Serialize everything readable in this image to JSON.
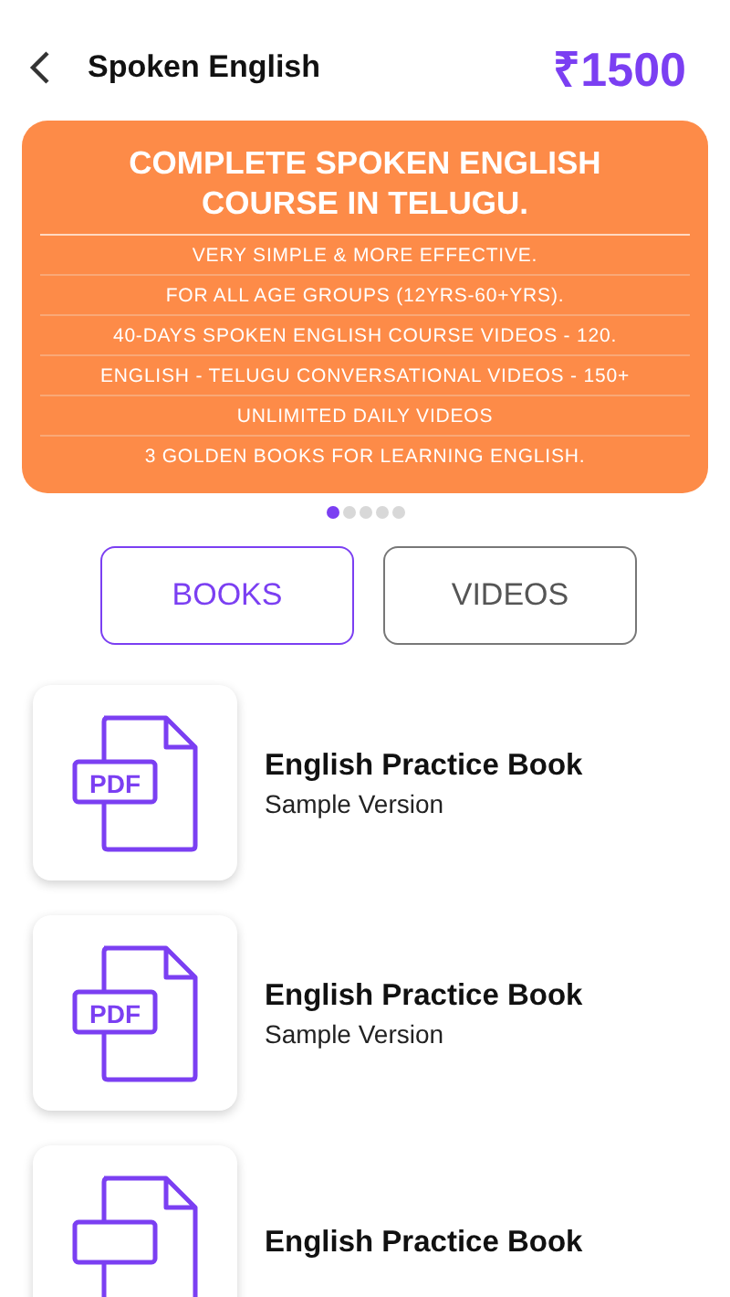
{
  "header": {
    "title": "Spoken English",
    "price": "₹1500"
  },
  "banner": {
    "heading": "COMPLETE SPOKEN ENGLISH COURSE IN TELUGU.",
    "points": [
      "VERY SIMPLE & MORE EFFECTIVE.",
      "FOR ALL AGE GROUPS (12YRS-60+YRS).",
      "40-DAYS SPOKEN ENGLISH COURSE VIDEOS - 120.",
      "ENGLISH - TELUGU CONVERSATIONAL VIDEOS - 150+",
      "UNLIMITED DAILY VIDEOS",
      "3 GOLDEN BOOKS FOR LEARNING ENGLISH."
    ]
  },
  "pager": [
    {
      "selected": true
    },
    {
      "selected": false
    },
    {
      "selected": false
    },
    {
      "selected": false
    },
    {
      "selected": false
    }
  ],
  "tabs": [
    {
      "label": "BOOKS",
      "selected": true
    },
    {
      "label": "VIDEOS",
      "selected": false
    }
  ],
  "books": [
    {
      "icon_label": "PDF",
      "title": "English Practice Book",
      "subtitle": "Sample Version"
    },
    {
      "icon_label": "PDF",
      "title": "English Practice Book",
      "subtitle": "Sample Version"
    },
    {
      "title": "English Practice Book"
    }
  ]
}
